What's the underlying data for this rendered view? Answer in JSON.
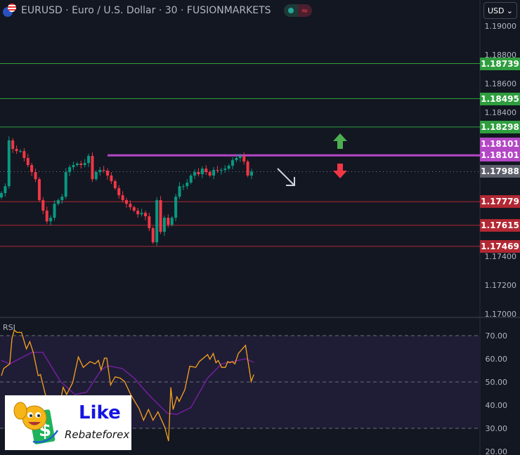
{
  "header": {
    "title": "EURUSD · Euro / U.S. Dollar · 30 · FUSIONMARKETS",
    "currency": "USD"
  },
  "colors": {
    "up": "#089981",
    "down": "#f23645",
    "resistance": "#2e9e3e",
    "support": "#b22833",
    "pivot": "#b447c6",
    "rsi": "#f7a21b",
    "rsi_ma": "#7e1fa8"
  },
  "price_axis": {
    "ticks": [
      "1.19000",
      "1.18800",
      "1.18600",
      "1.18400",
      "1.17400",
      "1.17200",
      "1.17000"
    ],
    "tick_values": [
      1.19,
      1.188,
      1.186,
      1.184,
      1.174,
      1.172,
      1.17
    ]
  },
  "levels": [
    {
      "label": "1.18739",
      "value": 1.18739,
      "kind": "resistance"
    },
    {
      "label": "1.18495",
      "value": 1.18495,
      "kind": "resistance"
    },
    {
      "label": "1.18298",
      "value": 1.18298,
      "kind": "resistance"
    },
    {
      "label": "1.18101",
      "value": 1.18101,
      "kind": "pivot"
    },
    {
      "label": "1.18101",
      "value": 1.18101,
      "kind": "pivot"
    },
    {
      "label": "1.17988",
      "value": 1.17988,
      "kind": "last"
    },
    {
      "label": "1.17779",
      "value": 1.17779,
      "kind": "support"
    },
    {
      "label": "1.17615",
      "value": 1.17615,
      "kind": "support"
    },
    {
      "label": "1.17469",
      "value": 1.17469,
      "kind": "support"
    }
  ],
  "closes": [
    1.17839,
    1.17887,
    1.18205,
    1.18146,
    1.18131,
    1.18131,
    1.18083,
    1.18034,
    1.17985,
    1.17936,
    1.1779,
    1.17717,
    1.17643,
    1.17668,
    1.17765,
    1.1779,
    1.17814,
    1.17985,
    1.18019,
    1.18034,
    1.18044,
    1.18034,
    1.18048,
    1.18097,
    1.17936,
    1.17985,
    1.18,
    1.17995,
    1.17961,
    1.17922,
    1.17873,
    1.17824,
    1.1779,
    1.17765,
    1.17741,
    1.17717,
    1.17692,
    1.17702,
    1.17678,
    1.17595,
    1.17497,
    1.1779,
    1.1757,
    1.17668,
    1.17619,
    1.17668,
    1.17814,
    1.17887,
    1.17887,
    1.17912,
    1.17961,
    1.17985,
    1.1797,
    1.18009,
    1.17985,
    1.17961,
    1.18,
    1.17995,
    1.18,
    1.18009,
    1.18029,
    1.18068,
    1.18083,
    1.18097,
    1.18058,
    1.17961,
    1.17988
  ],
  "rsi": {
    "label": "RSI",
    "ticks": [
      "70.00",
      "60.00",
      "50.00",
      "40.00",
      "30.00",
      "20.00"
    ],
    "values": [
      [
        0,
        52.7
      ],
      [
        0.6,
        55.8
      ],
      [
        2.2,
        57.8
      ],
      [
        2.8,
        68.9
      ],
      [
        3.4,
        72.4
      ],
      [
        4.1,
        71.4
      ],
      [
        5.3,
        71.4
      ],
      [
        6.6,
        64.3
      ],
      [
        7.5,
        67.4
      ],
      [
        8.4,
        62.8
      ],
      [
        9.7,
        52.7
      ],
      [
        10.3,
        53.2
      ],
      [
        11.6,
        44.6
      ],
      [
        13.1,
        40
      ],
      [
        14.4,
        38
      ],
      [
        15.6,
        42
      ],
      [
        16.3,
        47.7
      ],
      [
        17.2,
        44.6
      ],
      [
        18.8,
        49.7
      ],
      [
        20.3,
        60.8
      ],
      [
        21.6,
        56.3
      ],
      [
        23.4,
        58.8
      ],
      [
        24.7,
        57.8
      ],
      [
        25.6,
        59.3
      ],
      [
        26.3,
        55.2
      ],
      [
        27.2,
        60.3
      ],
      [
        27.8,
        60.3
      ],
      [
        28.8,
        48.7
      ],
      [
        30,
        52.2
      ],
      [
        31.3,
        51.7
      ],
      [
        32.5,
        50.2
      ],
      [
        34.1,
        44.6
      ],
      [
        35,
        42.1
      ],
      [
        36.3,
        38.6
      ],
      [
        37.5,
        33.5
      ],
      [
        38.8,
        38.1
      ],
      [
        40,
        33.5
      ],
      [
        41.3,
        37.1
      ],
      [
        43.1,
        30.5
      ],
      [
        44.1,
        24.5
      ],
      [
        44.7,
        47.7
      ],
      [
        45.3,
        38.1
      ],
      [
        46.3,
        43.6
      ],
      [
        46.9,
        41.6
      ],
      [
        48.4,
        46.7
      ],
      [
        49.7,
        56.8
      ],
      [
        51.3,
        56.3
      ],
      [
        52.2,
        58.8
      ],
      [
        54.4,
        61.8
      ],
      [
        55,
        59.8
      ],
      [
        55.9,
        62.3
      ],
      [
        56.6,
        58.3
      ],
      [
        57.2,
        59.3
      ],
      [
        58.1,
        56.3
      ],
      [
        59.1,
        56.3
      ],
      [
        59.7,
        58.8
      ],
      [
        60.3,
        58.3
      ],
      [
        60.9,
        58.8
      ],
      [
        61.6,
        57.8
      ],
      [
        62.5,
        62.3
      ],
      [
        64.4,
        65.8
      ],
      [
        65.9,
        50.2
      ],
      [
        66.6,
        53.2
      ]
    ],
    "ma": [
      [
        0,
        59.3
      ],
      [
        2.2,
        57.8
      ],
      [
        6.3,
        61.3
      ],
      [
        8.1,
        62.8
      ],
      [
        10.9,
        62.8
      ],
      [
        15.6,
        50.2
      ],
      [
        19.4,
        44.6
      ],
      [
        22.5,
        45.6
      ],
      [
        26.3,
        55.2
      ],
      [
        28.1,
        57
      ],
      [
        31.9,
        55.8
      ],
      [
        35,
        51.7
      ],
      [
        38.8,
        44.6
      ],
      [
        43.8,
        36.5
      ],
      [
        46.3,
        36
      ],
      [
        50,
        39
      ],
      [
        54.4,
        51.7
      ],
      [
        58.1,
        57.8
      ],
      [
        64.4,
        60
      ],
      [
        66.6,
        58.5
      ]
    ]
  },
  "logo": {
    "line1": "Like",
    "line2": "Rebateforex"
  }
}
